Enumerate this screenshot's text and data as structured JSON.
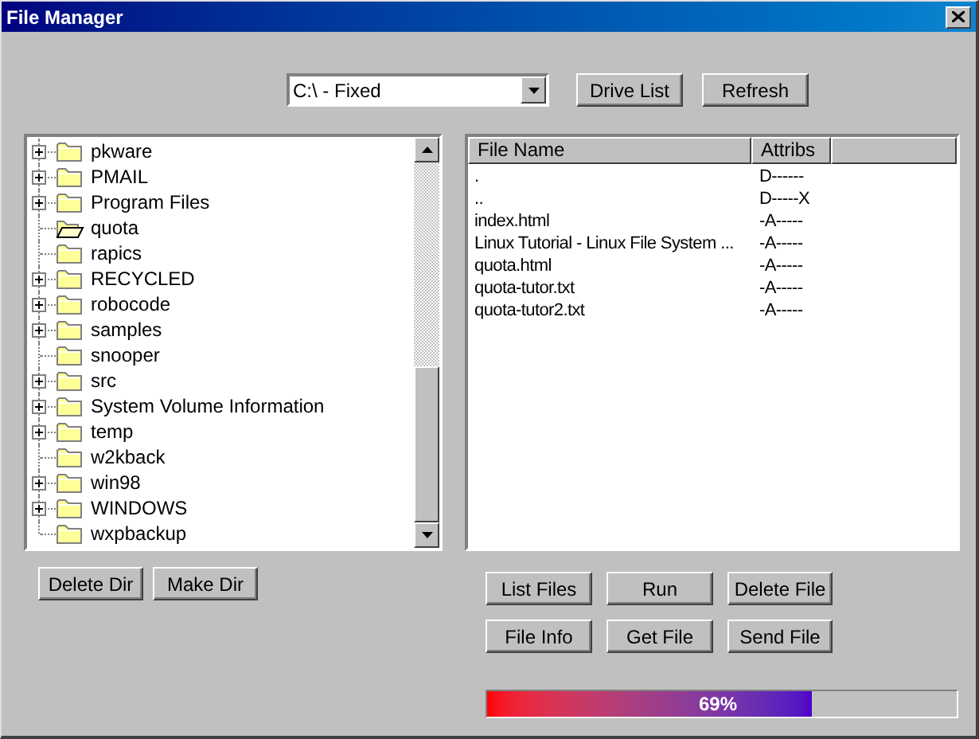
{
  "window": {
    "title": "File Manager"
  },
  "drive_select": {
    "value": "C:\\ - Fixed"
  },
  "top_buttons": [
    "Drive List",
    "Refresh"
  ],
  "folder_tree": [
    {
      "name": "pkware",
      "expandable": true,
      "open": false
    },
    {
      "name": "PMAIL",
      "expandable": true,
      "open": false
    },
    {
      "name": "Program Files",
      "expandable": true,
      "open": false
    },
    {
      "name": "quota",
      "expandable": false,
      "open": true
    },
    {
      "name": "rapics",
      "expandable": false,
      "open": false
    },
    {
      "name": "RECYCLED",
      "expandable": true,
      "open": false
    },
    {
      "name": "robocode",
      "expandable": true,
      "open": false
    },
    {
      "name": "samples",
      "expandable": true,
      "open": false
    },
    {
      "name": "snooper",
      "expandable": false,
      "open": false
    },
    {
      "name": "src",
      "expandable": true,
      "open": false
    },
    {
      "name": "System Volume Information",
      "expandable": true,
      "open": false
    },
    {
      "name": "temp",
      "expandable": true,
      "open": false
    },
    {
      "name": "w2kback",
      "expandable": false,
      "open": false
    },
    {
      "name": "win98",
      "expandable": true,
      "open": false
    },
    {
      "name": "WINDOWS",
      "expandable": true,
      "open": false
    },
    {
      "name": "wxpbackup",
      "expandable": false,
      "open": false
    }
  ],
  "file_list": {
    "columns": [
      "File Name",
      "Attribs"
    ],
    "rows": [
      {
        "name": ".",
        "attribs": "D------"
      },
      {
        "name": "..",
        "attribs": "D-----X"
      },
      {
        "name": "index.html",
        "attribs": "-A-----"
      },
      {
        "name": "Linux Tutorial - Linux File System ...",
        "attribs": "-A-----"
      },
      {
        "name": "quota.html",
        "attribs": "-A-----"
      },
      {
        "name": "quota-tutor.txt",
        "attribs": "-A-----"
      },
      {
        "name": "quota-tutor2.txt",
        "attribs": "-A-----"
      }
    ]
  },
  "dir_buttons": [
    "Delete Dir",
    "Make Dir"
  ],
  "file_buttons": [
    "List Files",
    "Run",
    "Delete File",
    "File Info",
    "Get File",
    "Send File"
  ],
  "progress": {
    "level": 0.69,
    "label": "69%"
  }
}
